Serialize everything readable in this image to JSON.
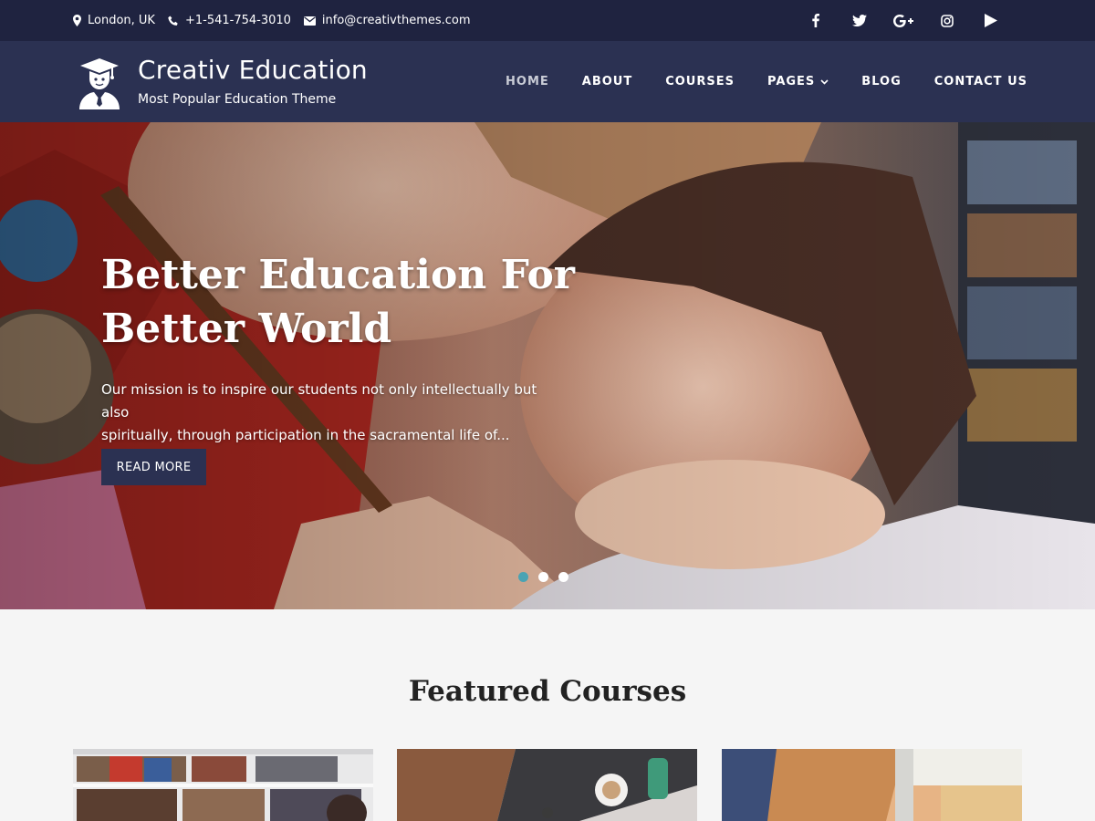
{
  "topbar": {
    "location": "London, UK",
    "phone": "+1-541-754-3010",
    "email": "info@creativthemes.com",
    "social_icons": [
      "facebook-icon",
      "twitter-icon",
      "google-plus-icon",
      "instagram-icon",
      "youtube-play-icon"
    ]
  },
  "header": {
    "site_title": "Creativ Education",
    "tagline": "Most Popular Education Theme",
    "logo_icon": "graduate-icon"
  },
  "nav": {
    "items": [
      {
        "label": "HOME",
        "active": true
      },
      {
        "label": "ABOUT"
      },
      {
        "label": "COURSES"
      },
      {
        "label": "PAGES",
        "has_dropdown": true
      },
      {
        "label": "BLOG"
      },
      {
        "label": "CONTACT US"
      }
    ]
  },
  "hero": {
    "title_line1": "Better Education For",
    "title_line2": "Better World",
    "text_line1": "Our mission is to inspire our students not only intellectually but also",
    "text_line2": "spiritually, through participation in the sacramental life of...",
    "button_label": "READ MORE",
    "slides": 3,
    "active_slide": 1
  },
  "featured": {
    "title": "Featured Courses"
  },
  "colors": {
    "topbar_bg": "#1f2340",
    "header_bg": "#2b3152",
    "accent_dot": "#4aa3b3",
    "page_bg": "#f5f5f5"
  }
}
